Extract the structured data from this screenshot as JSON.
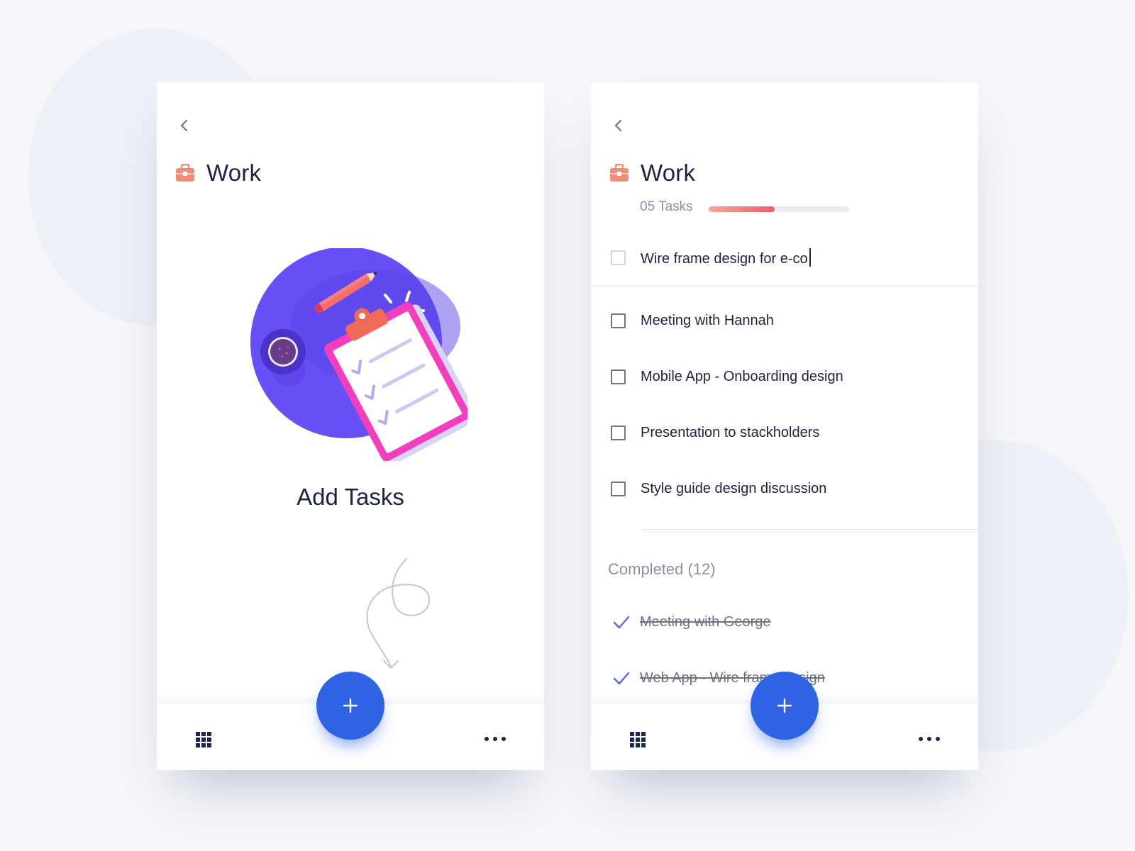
{
  "left_screen": {
    "title": "Work",
    "empty_state_title": "Add Tasks",
    "fab_label": "+"
  },
  "right_screen": {
    "title": "Work",
    "task_count": "05 Tasks",
    "progress_fraction": 0.47,
    "new_task_input": "Wire frame design for e-co",
    "tasks": [
      {
        "label": "Meeting with Hannah",
        "checked": false
      },
      {
        "label": "Mobile App - Onboarding design",
        "checked": false
      },
      {
        "label": "Presentation to stackholders",
        "checked": false
      },
      {
        "label": "Style guide design discussion",
        "checked": false
      }
    ],
    "completed_header": "Completed (12)",
    "completed_tasks": [
      {
        "label": "Meeting with George"
      },
      {
        "label": "Web App - Wire frame design"
      }
    ],
    "fab_label": "+"
  },
  "icons": [
    "back-chevron-icon",
    "briefcase-icon",
    "grid-icon",
    "more-dots-icon",
    "plus-icon",
    "check-icon"
  ],
  "colors": {
    "accent_blue": "#2f63e3",
    "briefcase": "#f08c77",
    "progress_start": "#f4a694",
    "progress_end": "#ee5e6e",
    "illustration_purple": "#6650f5",
    "clipboard_pink": "#f23fbd",
    "check_purple": "#5e63e8",
    "text_dark": "#1d2240",
    "text_muted": "#8a90a8"
  }
}
